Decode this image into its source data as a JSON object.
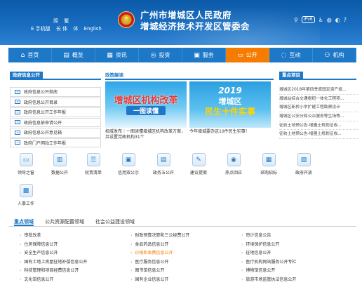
{
  "header": {
    "lang_row1": "简 繁",
    "lang_row2": [
      "E 手机版",
      "长 体",
      "体",
      "English"
    ],
    "title_line1": "广州市增城区人民政府",
    "title_line2": "增城经济技术开发区管委会",
    "tools": {
      "ipv6": "IPv6"
    }
  },
  "nav": [
    {
      "label": "首页",
      "icon": "home-icon",
      "glyph": "⌂"
    },
    {
      "label": "概览",
      "icon": "overview-icon",
      "glyph": "▤"
    },
    {
      "label": "资讯",
      "icon": "news-icon",
      "glyph": "▦"
    },
    {
      "label": "投资",
      "icon": "globe-icon",
      "glyph": "◎"
    },
    {
      "label": "服务",
      "icon": "service-icon",
      "glyph": "▣"
    },
    {
      "label": "公开",
      "icon": "public-icon",
      "glyph": "▭",
      "active": true
    },
    {
      "label": "互动",
      "icon": "interact-icon",
      "glyph": "◌"
    },
    {
      "label": "机构",
      "icon": "org-icon",
      "glyph": "⚇"
    }
  ],
  "public_info": {
    "heading": "政府信息公开",
    "items": [
      "政府信息公开指南",
      "政府信息公开目录",
      "政府信息公开工作年报",
      "政府信息依申请公开",
      "政府信息公开意见箱",
      "政府门户网站工作年报"
    ]
  },
  "policy": {
    "heading": "政策解读",
    "cards": [
      {
        "img_line1": "增城区机构改革",
        "img_line2": "一图读懂",
        "caption": "权威发布｜一图读懂增城区机构改革方案，共设置党政机构31个"
      },
      {
        "img_year": "2019",
        "img_city": "增城区",
        "img_main": "民生十件实事",
        "caption": "今年增城要办这10件民生实事！"
      }
    ]
  },
  "key_projects": {
    "heading": "重点项目",
    "items": [
      "增城区2018年第四季度固定资产投...",
      "增城站综合交通枢纽一体化工程项...",
      "增城区新桥小学扩建工程勘察设计",
      "增城区公安分局公众服务等生场等...",
      "征收土地预公告-增圃土规划征收...",
      "征收土地预公告-增圃土规划征收..."
    ]
  },
  "quick_icons": [
    {
      "label": "领导之窗",
      "icon": "leader-icon",
      "glyph": "▭"
    },
    {
      "label": "数据公开",
      "icon": "data-icon",
      "glyph": "▥"
    },
    {
      "label": "权责清单",
      "icon": "list-icon",
      "glyph": "☰"
    },
    {
      "label": "信用双公示",
      "icon": "credit-icon",
      "glyph": "▣"
    },
    {
      "label": "政务五公开",
      "icon": "five-open-icon",
      "glyph": "▤"
    },
    {
      "label": "建议提案",
      "icon": "proposal-icon",
      "glyph": "✎"
    },
    {
      "label": "热点回应",
      "icon": "hotspot-icon",
      "glyph": "◉"
    },
    {
      "label": "采购招标",
      "icon": "purchase-icon",
      "glyph": "▦"
    },
    {
      "label": "政府开放",
      "icon": "open-icon",
      "glyph": "▧"
    },
    {
      "label": "人事工作",
      "icon": "personnel-icon",
      "glyph": "▩"
    }
  ],
  "bottom_tabs": [
    "重点领域",
    "公共资源配置领域",
    "社会公益建设领域"
  ],
  "bottom_lists": [
    [
      "审批改革",
      "住房保障信息公开",
      "安全生产信息公开",
      "国有土地上房屋征地补偿信息公开",
      "科技管理和项目经费信息公开",
      "文化馆信息公开"
    ],
    [
      "财政预算决算和三公经费公开",
      "食品药品信息公开",
      "价格和收费信息公开",
      "医疗服务信息公开",
      "图书馆信息公开",
      "国有企业信息公开"
    ],
    [
      "审计信息公告",
      "环境保护信息公开",
      "征地信息公开",
      "医疗机构网站服务公开专栏",
      "博物馆信息公开",
      "旅游市场监管执法信息公开"
    ]
  ]
}
